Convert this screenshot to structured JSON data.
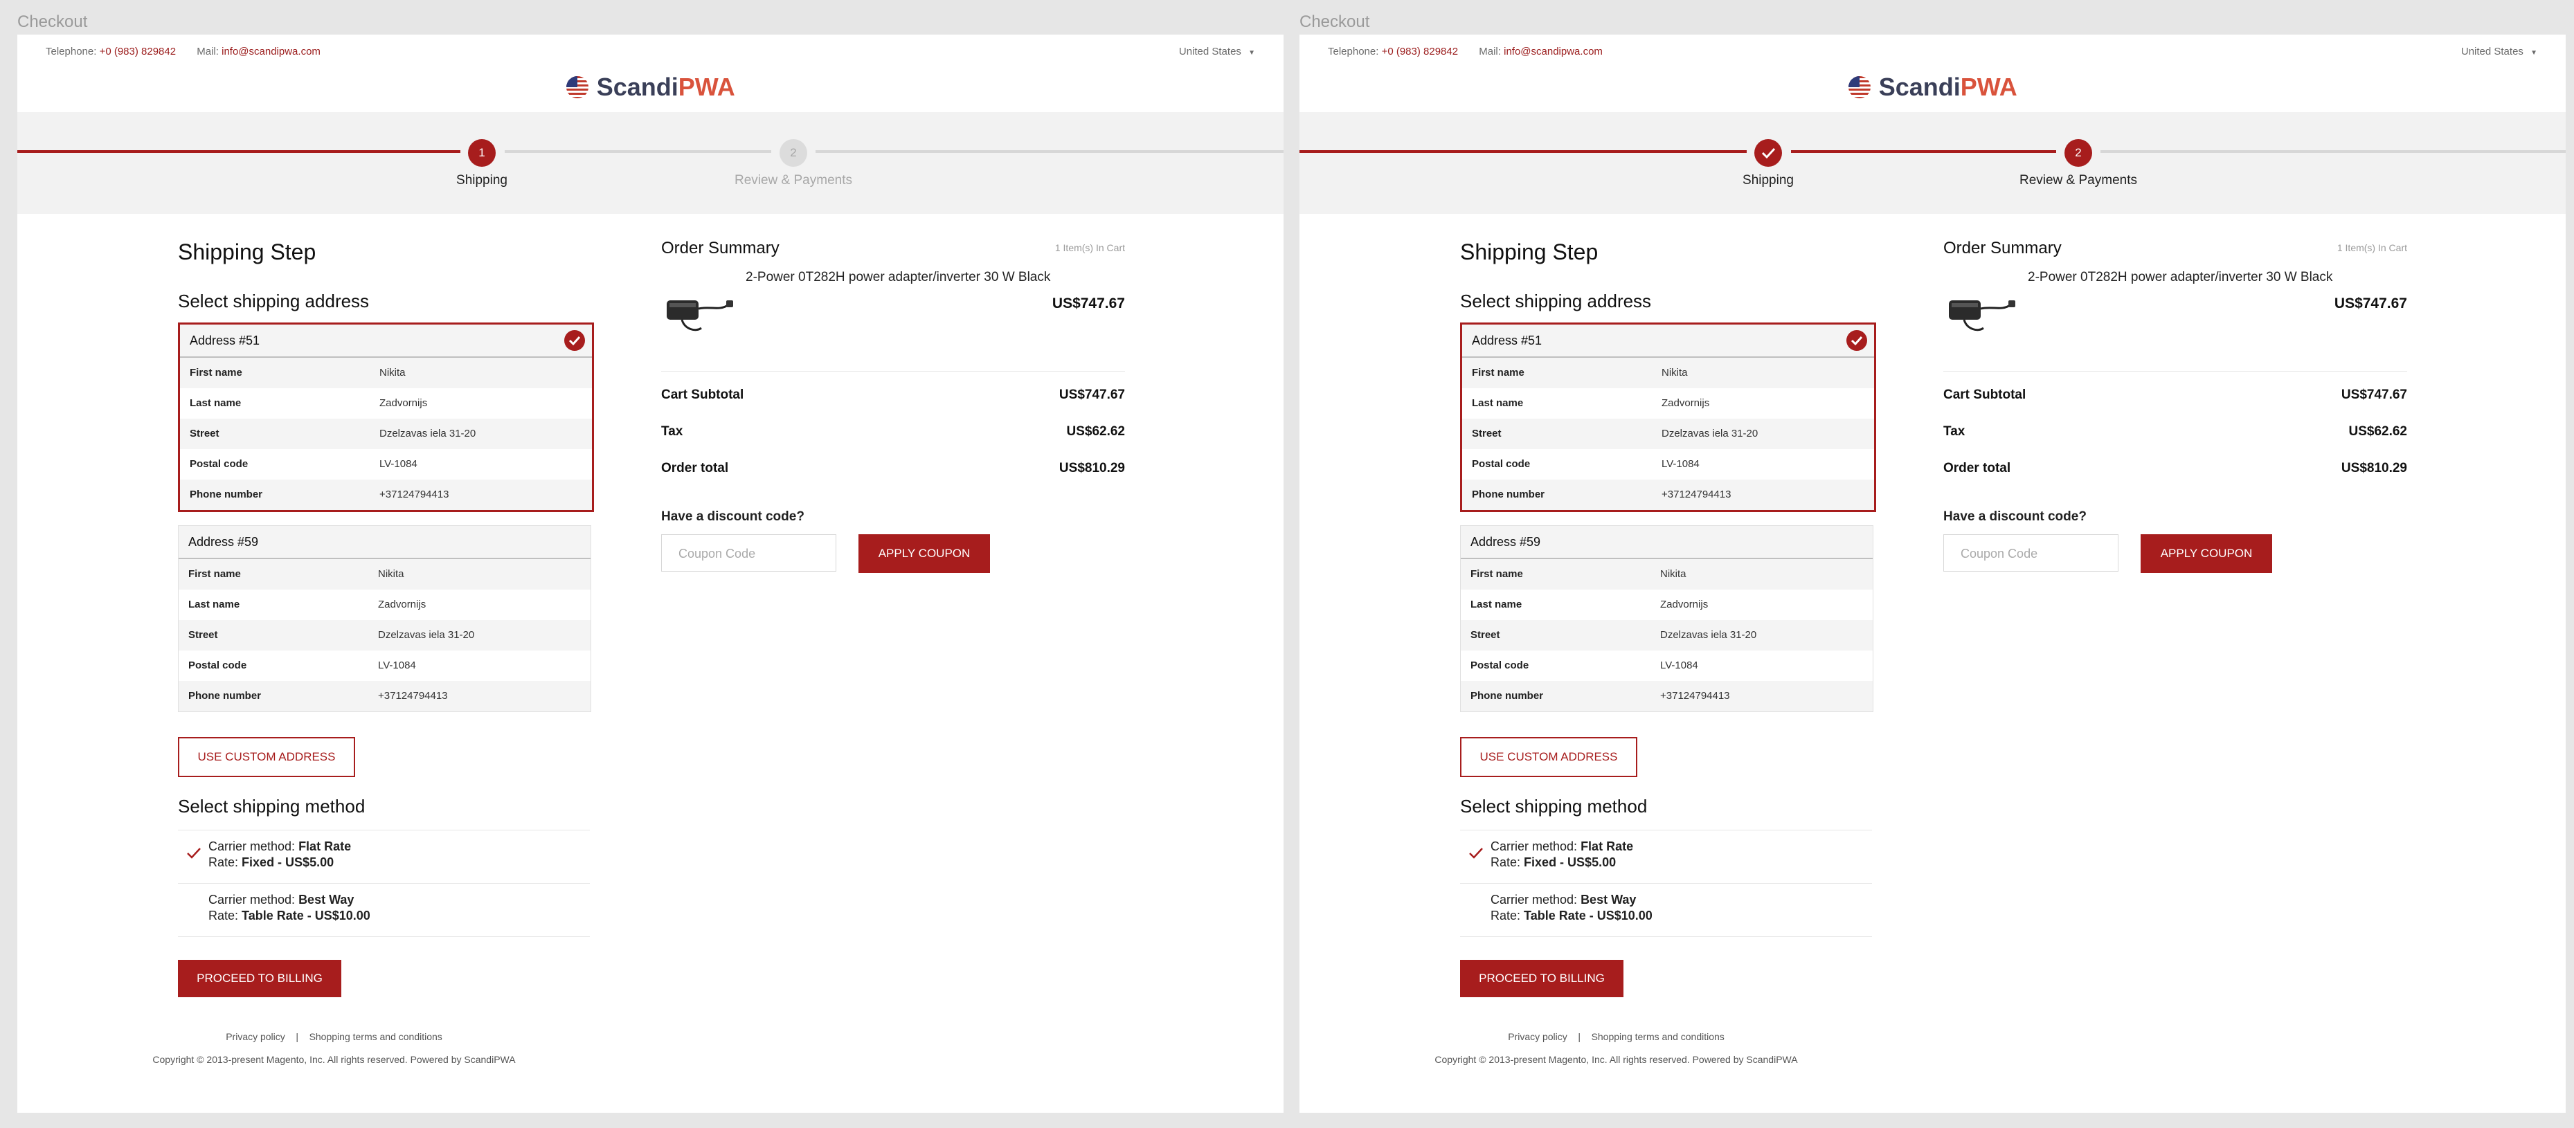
{
  "frames": [
    {
      "title": "Checkout",
      "header": {
        "telephone_label": "Telephone:",
        "telephone": "+0 (983) 829842",
        "mail_label": "Mail:",
        "mail": "info@scandipwa.com",
        "country": "United States",
        "brand_left": "Scandi",
        "brand_right": "PWA"
      },
      "steps": [
        {
          "number": "1",
          "label": "Shipping",
          "state": "active"
        },
        {
          "number": "2",
          "label": "Review & Payments",
          "state": "inactive"
        }
      ],
      "shipping": {
        "title": "Shipping Step",
        "select_address": "Select shipping address",
        "addresses": [
          {
            "title": "Address #51",
            "selected": true,
            "rows": [
              {
                "key": "First name",
                "value": "Nikita"
              },
              {
                "key": "Last name",
                "value": "Zadvornijs"
              },
              {
                "key": "Street",
                "value": "Dzelzavas iela 31-20"
              },
              {
                "key": "Postal code",
                "value": "LV-1084"
              },
              {
                "key": "Phone number",
                "value": "+37124794413"
              }
            ]
          },
          {
            "title": "Address #59",
            "selected": false,
            "rows": [
              {
                "key": "First name",
                "value": "Nikita"
              },
              {
                "key": "Last name",
                "value": "Zadvornijs"
              },
              {
                "key": "Street",
                "value": "Dzelzavas iela 31-20"
              },
              {
                "key": "Postal code",
                "value": "LV-1084"
              },
              {
                "key": "Phone number",
                "value": "+37124794413"
              }
            ]
          }
        ],
        "custom_address_button": "USE CUSTOM ADDRESS",
        "select_method": "Select shipping method",
        "methods": [
          {
            "carrier_label": "Carrier method:",
            "carrier": "Flat Rate",
            "rate_label": "Rate:",
            "rate": "Fixed - US$5.00",
            "selected": true
          },
          {
            "carrier_label": "Carrier method:",
            "carrier": "Best Way",
            "rate_label": "Rate:",
            "rate": "Table Rate - US$10.00",
            "selected": false
          }
        ],
        "proceed_button": "PROCEED TO BILLING"
      },
      "summary": {
        "title": "Order Summary",
        "count": "1 Item(s) In Cart",
        "product_name": "2-Power 0T282H power adapter/inverter 30 W Black",
        "product_price": "US$747.67",
        "totals": [
          {
            "label": "Cart Subtotal",
            "value": "US$747.67"
          },
          {
            "label": "Tax",
            "value": "US$62.62"
          },
          {
            "label": "Order total",
            "value": "US$810.29"
          }
        ],
        "discount_question": "Have a discount code?",
        "coupon_placeholder": "Coupon Code",
        "apply_button": "APPLY COUPON"
      },
      "footer": {
        "privacy": "Privacy policy",
        "separator": "|",
        "terms": "Shopping terms and conditions",
        "copyright": "Copyright © 2013-present Magento, Inc. All rights reserved. Powered by ScandiPWA"
      }
    },
    {
      "title": "Checkout",
      "header": {
        "telephone_label": "Telephone:",
        "telephone": "+0 (983) 829842",
        "mail_label": "Mail:",
        "mail": "info@scandipwa.com",
        "country": "United States",
        "brand_left": "Scandi",
        "brand_right": "PWA"
      },
      "steps": [
        {
          "number": "",
          "label": "Shipping",
          "state": "done"
        },
        {
          "number": "2",
          "label": "Review & Payments",
          "state": "active"
        }
      ],
      "shipping": {
        "title": "Shipping Step",
        "select_address": "Select shipping address",
        "addresses": [
          {
            "title": "Address #51",
            "selected": true,
            "rows": [
              {
                "key": "First name",
                "value": "Nikita"
              },
              {
                "key": "Last name",
                "value": "Zadvornijs"
              },
              {
                "key": "Street",
                "value": "Dzelzavas iela 31-20"
              },
              {
                "key": "Postal code",
                "value": "LV-1084"
              },
              {
                "key": "Phone number",
                "value": "+37124794413"
              }
            ]
          },
          {
            "title": "Address #59",
            "selected": false,
            "rows": [
              {
                "key": "First name",
                "value": "Nikita"
              },
              {
                "key": "Last name",
                "value": "Zadvornijs"
              },
              {
                "key": "Street",
                "value": "Dzelzavas iela 31-20"
              },
              {
                "key": "Postal code",
                "value": "LV-1084"
              },
              {
                "key": "Phone number",
                "value": "+37124794413"
              }
            ]
          }
        ],
        "custom_address_button": "USE CUSTOM ADDRESS",
        "select_method": "Select shipping method",
        "methods": [
          {
            "carrier_label": "Carrier method:",
            "carrier": "Flat Rate",
            "rate_label": "Rate:",
            "rate": "Fixed - US$5.00",
            "selected": true
          },
          {
            "carrier_label": "Carrier method:",
            "carrier": "Best Way",
            "rate_label": "Rate:",
            "rate": "Table Rate - US$10.00",
            "selected": false
          }
        ],
        "proceed_button": "PROCEED TO BILLING"
      },
      "summary": {
        "title": "Order Summary",
        "count": "1 Item(s) In Cart",
        "product_name": "2-Power 0T282H power adapter/inverter 30 W Black",
        "product_price": "US$747.67",
        "totals": [
          {
            "label": "Cart Subtotal",
            "value": "US$747.67"
          },
          {
            "label": "Tax",
            "value": "US$62.62"
          },
          {
            "label": "Order total",
            "value": "US$810.29"
          }
        ],
        "discount_question": "Have a discount code?",
        "coupon_placeholder": "Coupon Code",
        "apply_button": "APPLY COUPON"
      },
      "footer": {
        "privacy": "Privacy policy",
        "separator": "|",
        "terms": "Shopping terms and conditions",
        "copyright": "Copyright © 2013-present Magento, Inc. All rights reserved. Powered by ScandiPWA"
      }
    }
  ],
  "colors": {
    "accent": "#a71d1d",
    "brand_dark": "#3a3f58",
    "brand_orange": "#d9533c",
    "band": "#f2f2f2"
  }
}
